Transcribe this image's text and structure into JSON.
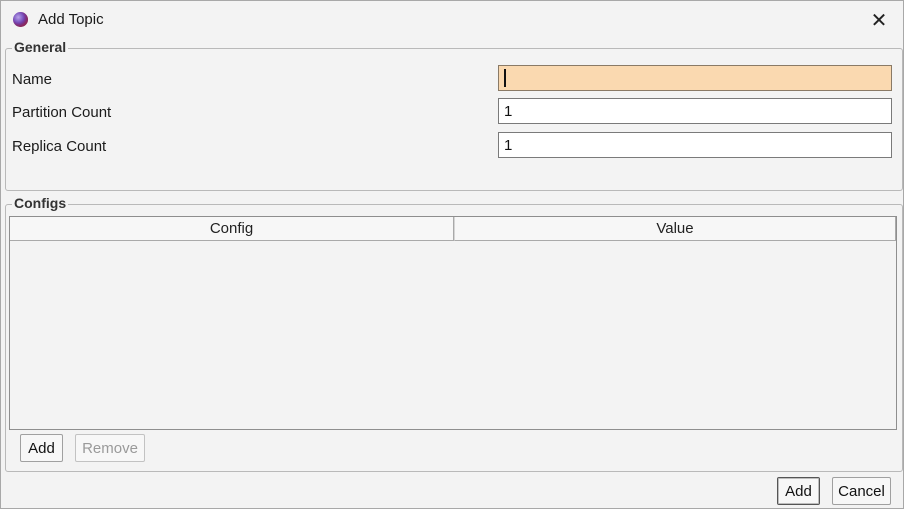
{
  "window": {
    "title": "Add Topic",
    "icon": "app-sphere-icon",
    "close_icon": "close-icon",
    "close_glyph": "✕"
  },
  "general": {
    "label": "General",
    "name": {
      "label": "Name",
      "value": ""
    },
    "partition_count": {
      "label": "Partition Count",
      "value": "1"
    },
    "replica_count": {
      "label": "Replica Count",
      "value": "1"
    }
  },
  "configs": {
    "label": "Configs",
    "columns": [
      "Config",
      "Value"
    ],
    "rows": [],
    "add_label": "Add",
    "remove_label": "Remove"
  },
  "footer": {
    "add_label": "Add",
    "cancel_label": "Cancel"
  },
  "colors": {
    "focused_field_bg": "#fad9b0",
    "window_bg": "#f3f3f3"
  }
}
